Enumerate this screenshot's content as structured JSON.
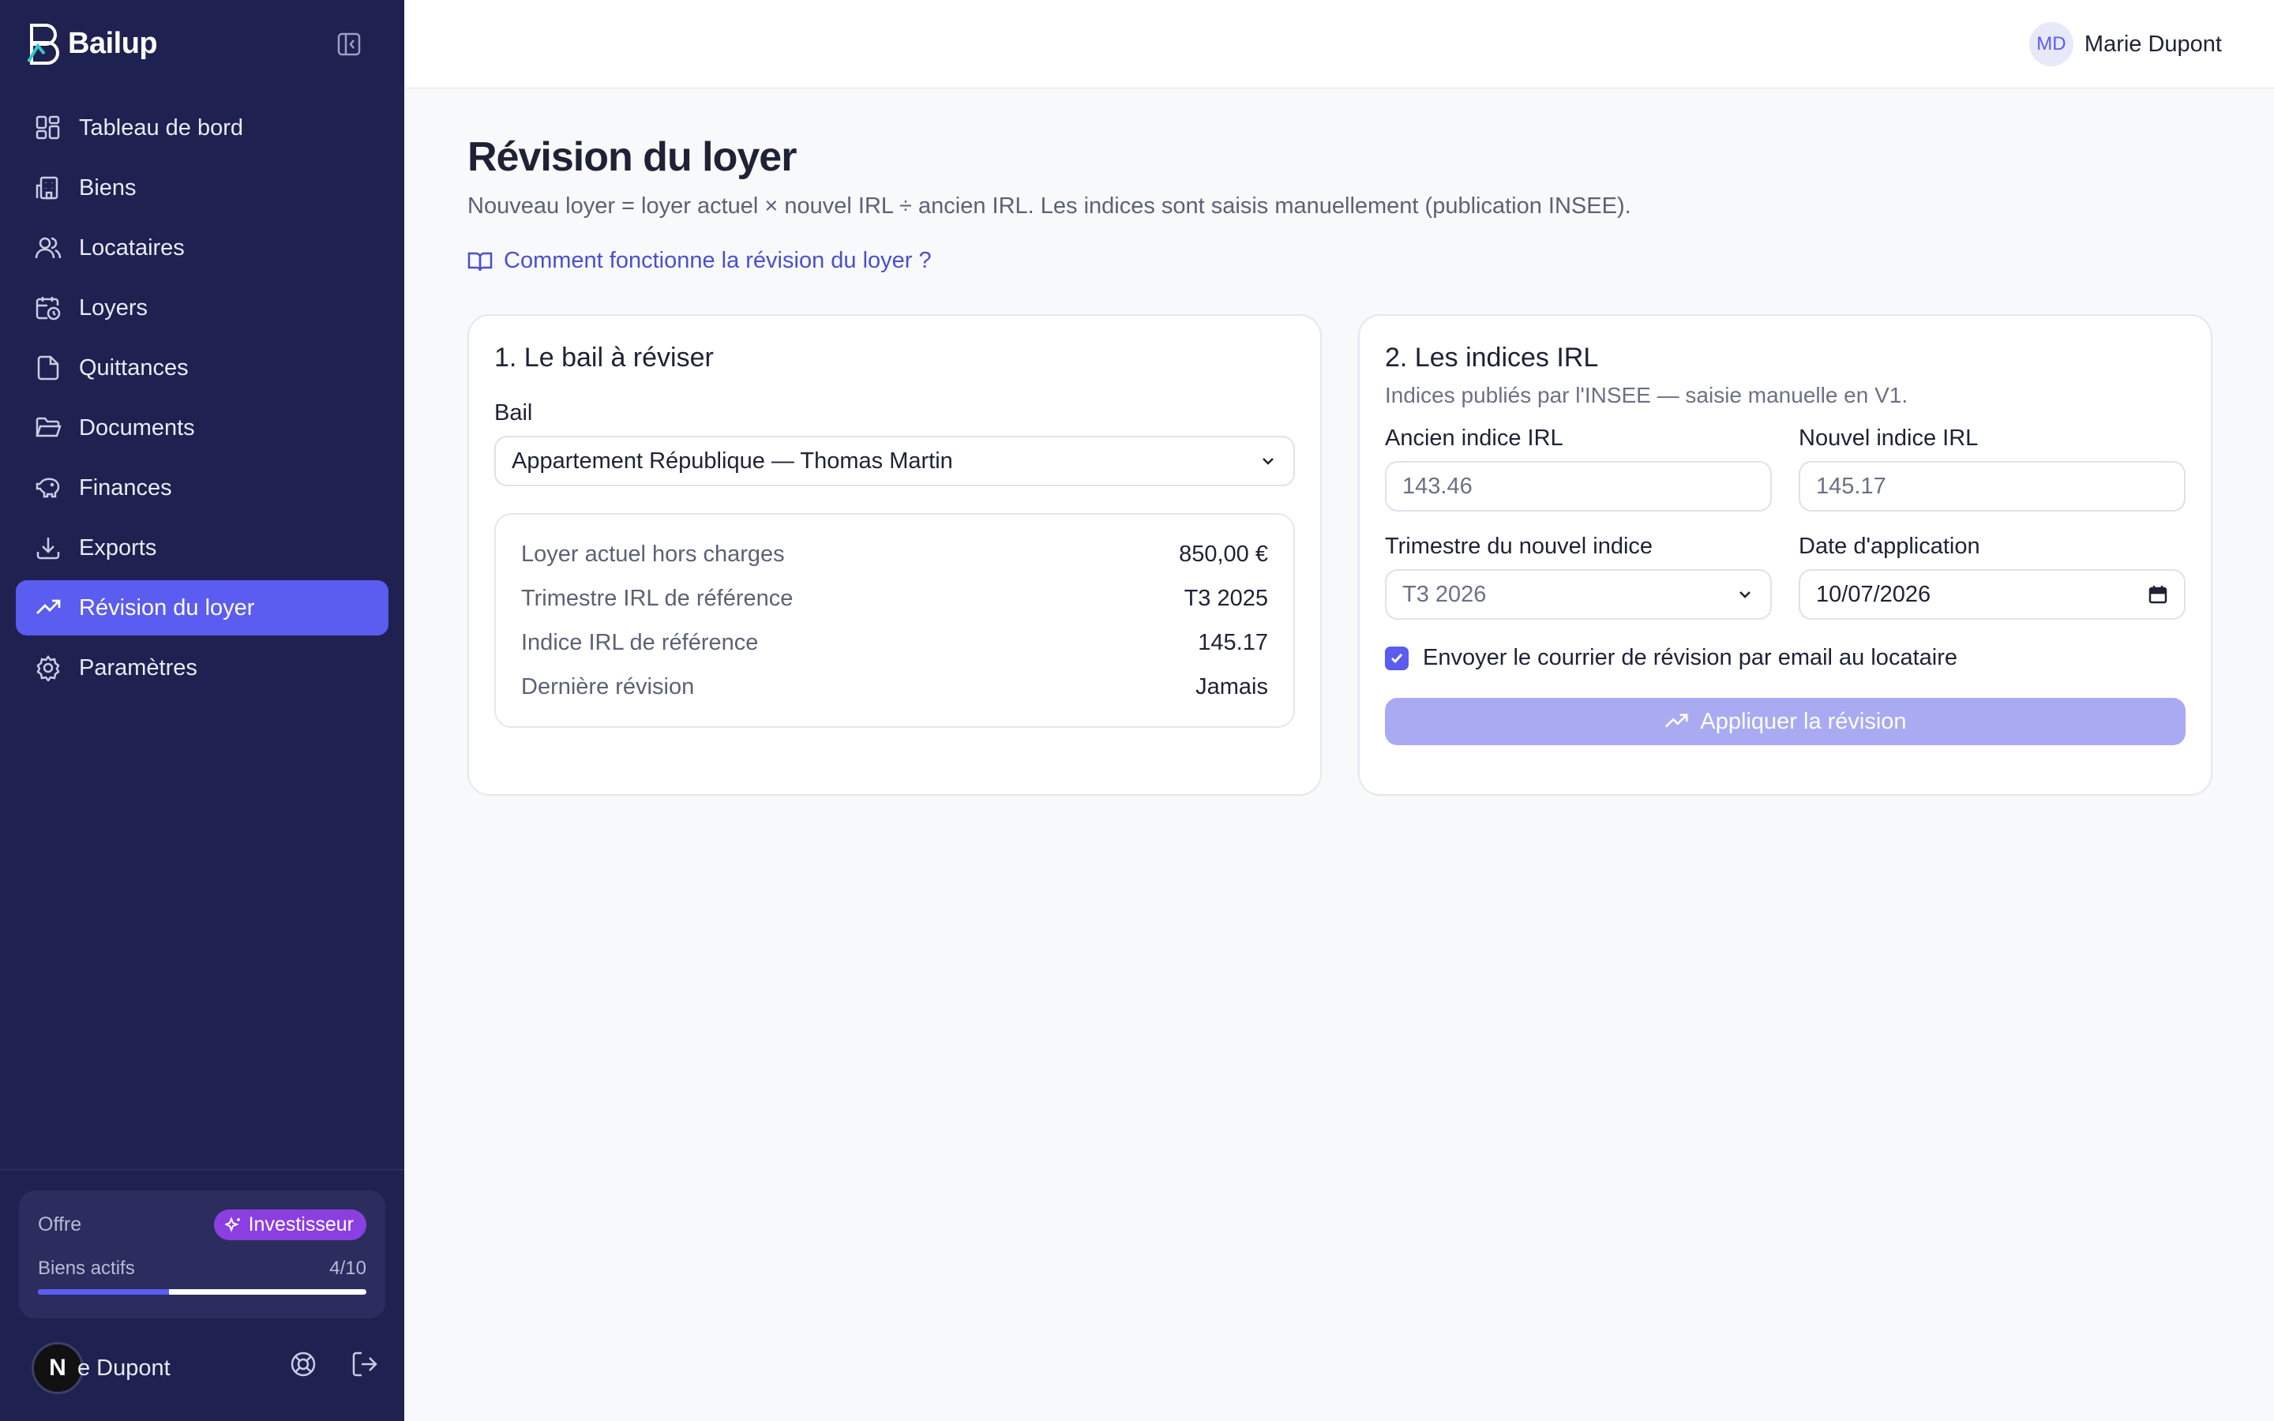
{
  "app": {
    "brand_name": "Bailup"
  },
  "sidebar": {
    "items": [
      {
        "label": "Tableau de bord",
        "icon": "dashboard-icon"
      },
      {
        "label": "Biens",
        "icon": "building-icon"
      },
      {
        "label": "Locataires",
        "icon": "users-icon"
      },
      {
        "label": "Loyers",
        "icon": "calendar-clock-icon"
      },
      {
        "label": "Quittances",
        "icon": "file-icon"
      },
      {
        "label": "Documents",
        "icon": "folder-icon"
      },
      {
        "label": "Finances",
        "icon": "piggy-bank-icon"
      },
      {
        "label": "Exports",
        "icon": "download-icon"
      },
      {
        "label": "Révision du loyer",
        "icon": "trending-up-icon",
        "active": true
      },
      {
        "label": "Paramètres",
        "icon": "gear-icon"
      }
    ],
    "plan": {
      "label": "Offre",
      "badge": "Investisseur",
      "active_label": "Biens actifs",
      "active_count": "4/10",
      "progress_fraction": 0.4
    },
    "user": {
      "avatar_letter": "N",
      "name": "e Dupont"
    }
  },
  "topbar": {
    "avatar_initials": "MD",
    "user_name": "Marie Dupont"
  },
  "page": {
    "title": "Révision du loyer",
    "subtitle": "Nouveau loyer = loyer actuel × nouvel IRL ÷ ancien IRL. Les indices sont saisis manuellement (publication INSEE).",
    "help_link": "Comment fonctionne la révision du loyer ?"
  },
  "lease_card": {
    "title": "1. Le bail à réviser",
    "lease_label": "Bail",
    "lease_value": "Appartement République — Thomas Martin",
    "info": [
      {
        "key": "Loyer actuel hors charges",
        "value": "850,00 €"
      },
      {
        "key": "Trimestre IRL de référence",
        "value": "T3 2025"
      },
      {
        "key": "Indice IRL de référence",
        "value": "145.17"
      },
      {
        "key": "Dernière révision",
        "value": "Jamais"
      }
    ]
  },
  "irl_card": {
    "title": "2. Les indices IRL",
    "subtitle": "Indices publiés par l'INSEE — saisie manuelle en V1.",
    "old_label": "Ancien indice IRL",
    "old_placeholder": "143.46",
    "new_label": "Nouvel indice IRL",
    "new_placeholder": "145.17",
    "quarter_label": "Trimestre du nouvel indice",
    "quarter_value": "T3 2026",
    "date_label": "Date d'application",
    "date_value": "10/07/2026",
    "send_email_label": "Envoyer le courrier de révision par email au locataire",
    "send_email_checked": true,
    "apply_label": "Appliquer la révision"
  },
  "colors": {
    "sidebar_bg": "#1f2150",
    "accent": "#5b5cf0",
    "badge": "#8b3fe0",
    "apply_disabled": "#a9aaf2"
  }
}
